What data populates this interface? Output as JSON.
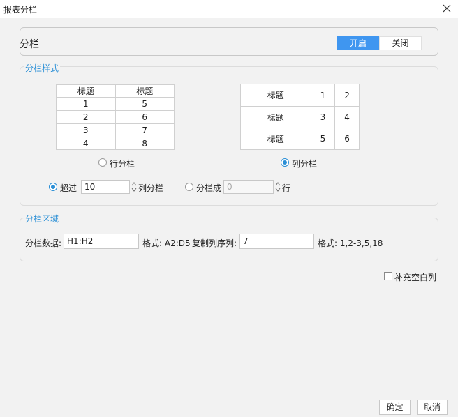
{
  "window": {
    "title": "报表分栏"
  },
  "toggle": {
    "label": "分栏",
    "on_label": "开启",
    "off_label": "关闭"
  },
  "style_section": {
    "title": "分栏样式",
    "row_table": {
      "header": [
        "标题",
        "标题"
      ],
      "rows": [
        [
          "1",
          "5"
        ],
        [
          "2",
          "6"
        ],
        [
          "3",
          "7"
        ],
        [
          "4",
          "8"
        ]
      ]
    },
    "col_table": {
      "rows": [
        [
          "标题",
          "1",
          "2"
        ],
        [
          "标题",
          "3",
          "4"
        ],
        [
          "标题",
          "5",
          "6"
        ]
      ]
    },
    "row_option_label": "行分栏",
    "col_option_label": "列分栏",
    "exceed_label": "超过",
    "exceed_value": "10",
    "exceed_suffix": "列分栏",
    "split_into_label": "分栏成",
    "split_into_value": "0",
    "split_into_suffix": "行"
  },
  "area_section": {
    "title": "分栏区域",
    "data_label": "分栏数据:",
    "data_value": "H1:H2",
    "data_hint": "格式: A2:D5",
    "copy_label": "复制列序列:",
    "copy_value": "7",
    "copy_hint": "格式: 1,2-3,5,18"
  },
  "fill_blank_label": "补充空白列",
  "buttons": {
    "ok": "确定",
    "cancel": "取消"
  },
  "colors": {
    "accent": "#3f96f0",
    "section_title": "#2a8fd6"
  }
}
